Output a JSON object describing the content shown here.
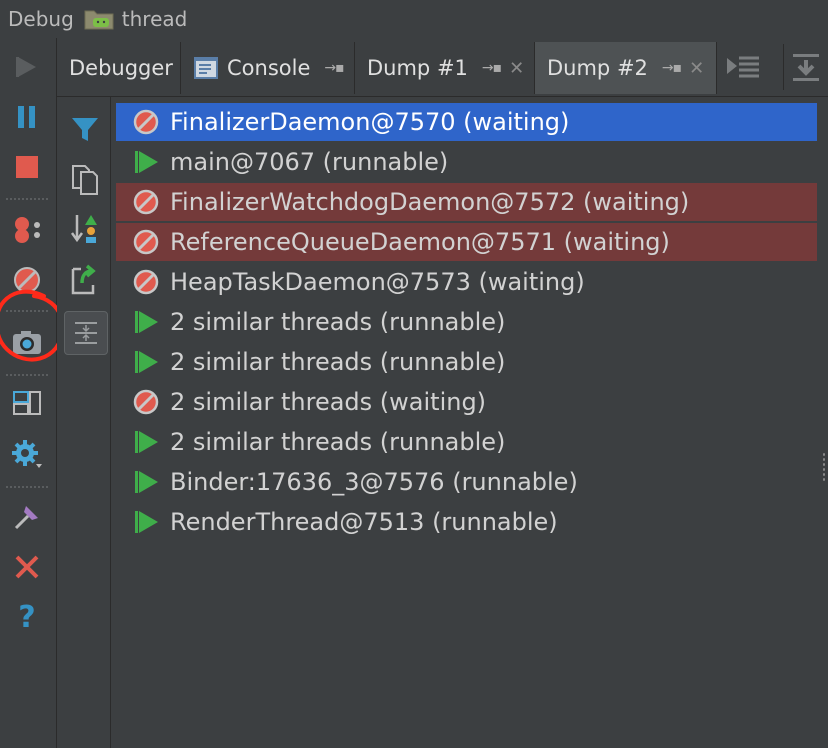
{
  "window": {
    "title_prefix": "Debug",
    "title": "thread",
    "folder_icon": "android-folder-icon"
  },
  "left_toolbar": [
    {
      "name": "resume-icon",
      "interactable": true
    },
    {
      "name": "pause-icon",
      "interactable": true
    },
    {
      "name": "stop-icon",
      "interactable": true
    },
    {
      "name": "view-breakpoints-icon",
      "interactable": true
    },
    {
      "name": "mute-breakpoints-icon",
      "interactable": true
    },
    {
      "name": "get-thread-dump-icon",
      "interactable": true
    },
    {
      "name": "restore-layout-icon",
      "interactable": true
    },
    {
      "name": "settings-icon",
      "interactable": true
    },
    {
      "name": "pin-icon",
      "interactable": true
    },
    {
      "name": "close-icon",
      "interactable": true
    },
    {
      "name": "help-icon",
      "interactable": true
    }
  ],
  "tabs": [
    {
      "label": "Debugger",
      "active": false,
      "pinned": false,
      "closable": false
    },
    {
      "label": "Console",
      "active": false,
      "pinned": true,
      "closable": false
    },
    {
      "label": "Dump #1",
      "active": false,
      "pinned": true,
      "closable": true
    },
    {
      "label": "Dump #2",
      "active": true,
      "pinned": true,
      "closable": true
    }
  ],
  "tab_glyphs": {
    "pin": "→▪",
    "close": "✕"
  },
  "dump_tools": [
    "filter-icon",
    "copy-icon",
    "sort-icon",
    "export-icon",
    "merge-similar-icon"
  ],
  "threads": [
    {
      "label": "FinalizerDaemon@7570 (waiting)",
      "state": "waiting",
      "style": "selected"
    },
    {
      "label": "main@7067 (runnable)",
      "state": "runnable",
      "style": ""
    },
    {
      "label": "FinalizerWatchdogDaemon@7572 (waiting)",
      "state": "waiting",
      "style": "error"
    },
    {
      "label": "ReferenceQueueDaemon@7571 (waiting)",
      "state": "waiting",
      "style": "error"
    },
    {
      "label": "HeapTaskDaemon@7573 (waiting)",
      "state": "waiting",
      "style": ""
    },
    {
      "label": "2 similar threads (runnable)",
      "state": "runnable",
      "style": ""
    },
    {
      "label": "2 similar threads (runnable)",
      "state": "runnable",
      "style": ""
    },
    {
      "label": "2 similar threads (waiting)",
      "state": "waiting",
      "style": ""
    },
    {
      "label": "2 similar threads (runnable)",
      "state": "runnable",
      "style": ""
    },
    {
      "label": "Binder:17636_3@7576 (runnable)",
      "state": "runnable",
      "style": ""
    },
    {
      "label": "RenderThread@7513 (runnable)",
      "state": "runnable",
      "style": ""
    }
  ],
  "colors": {
    "selection": "#2f65ca",
    "error_row": "#743a3a",
    "runnable": "#3fae4a",
    "waiting": "#e05a4e",
    "annotation_circle": "#ff2a1a"
  }
}
